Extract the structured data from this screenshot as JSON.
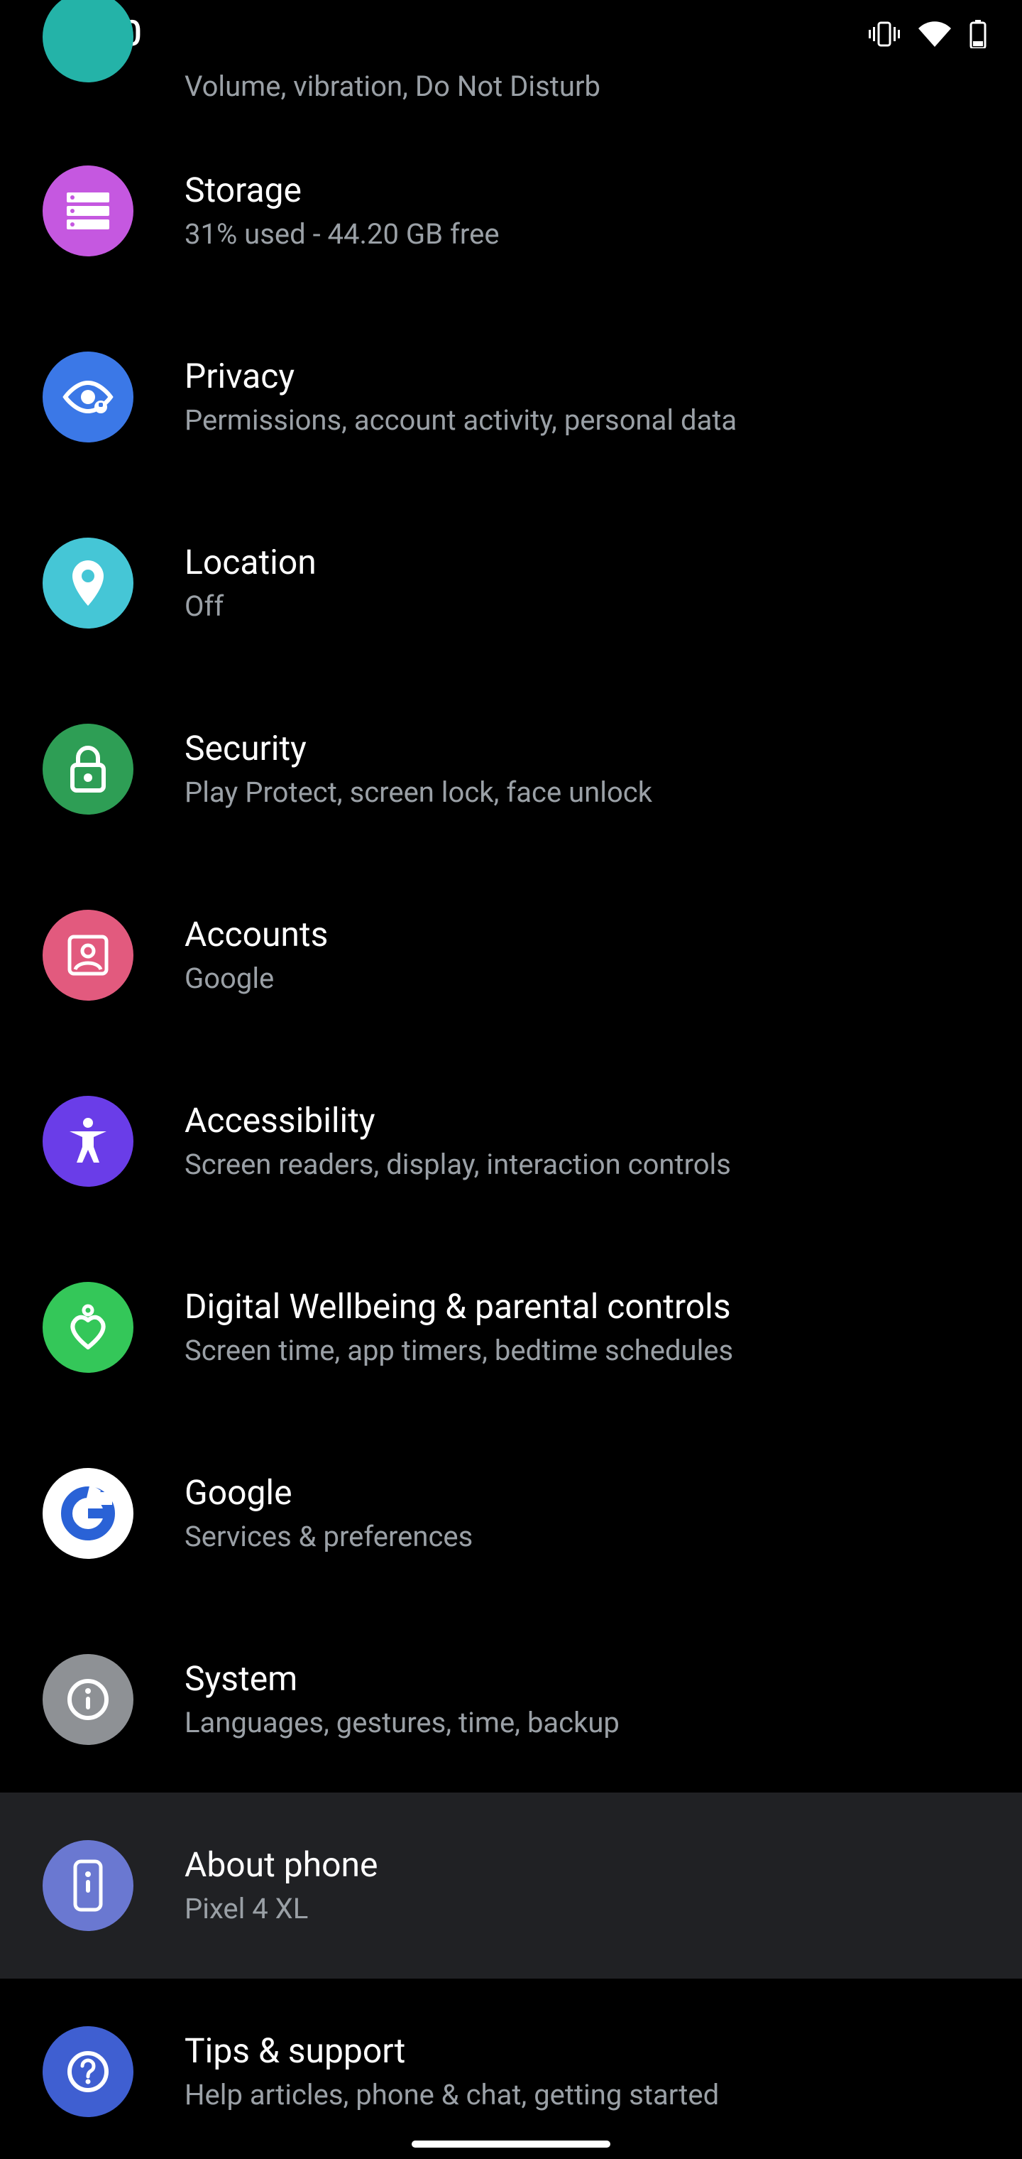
{
  "status": {
    "time": "1:00"
  },
  "items": [
    {
      "title": "",
      "sub": "Volume, vibration, Do Not Disturb"
    },
    {
      "title": "Storage",
      "sub": "31% used - 44.20 GB free"
    },
    {
      "title": "Privacy",
      "sub": "Permissions, account activity, personal data"
    },
    {
      "title": "Location",
      "sub": "Off"
    },
    {
      "title": "Security",
      "sub": "Play Protect, screen lock, face unlock"
    },
    {
      "title": "Accounts",
      "sub": "Google"
    },
    {
      "title": "Accessibility",
      "sub": "Screen readers, display, interaction controls"
    },
    {
      "title": "Digital Wellbeing & parental controls",
      "sub": "Screen time, app timers, bedtime schedules"
    },
    {
      "title": "Google",
      "sub": "Services & preferences"
    },
    {
      "title": "System",
      "sub": "Languages, gestures, time, backup"
    },
    {
      "title": "About phone",
      "sub": "Pixel 4 XL"
    },
    {
      "title": "Tips & support",
      "sub": "Help articles, phone & chat, getting started"
    }
  ]
}
